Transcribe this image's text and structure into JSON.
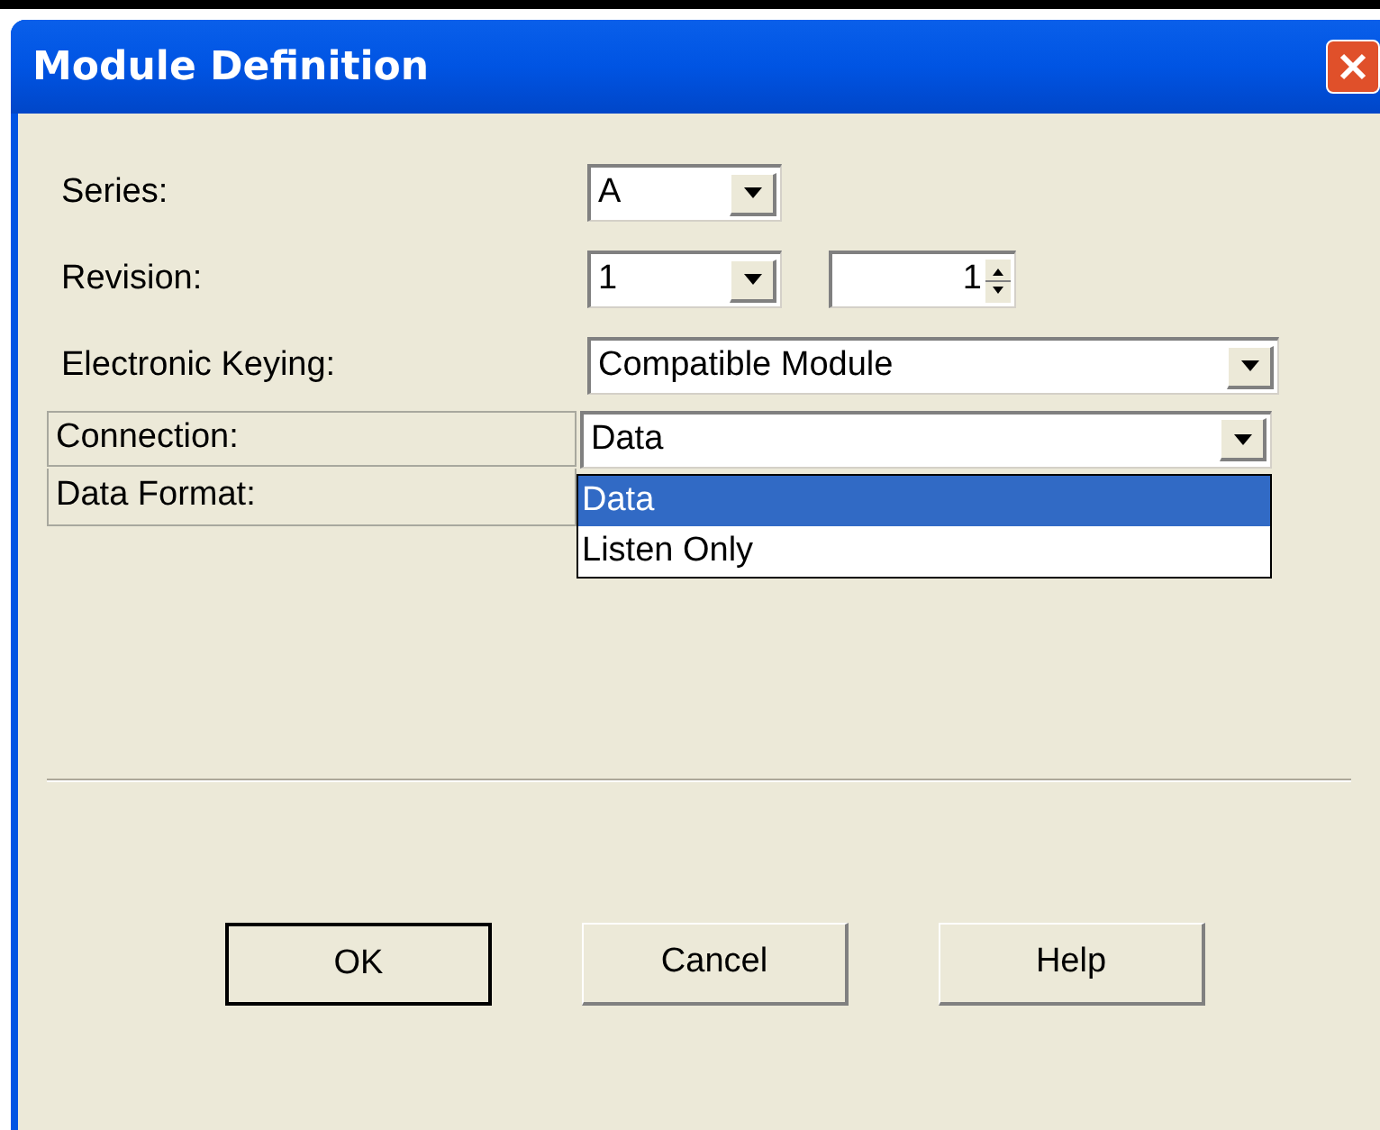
{
  "window": {
    "title": "Module Definition"
  },
  "fields": [
    {
      "kind": "combo",
      "label": "Series:",
      "value": "A"
    },
    {
      "kind": "combo_spin",
      "label": "Revision:",
      "value": "1",
      "spin_value": "1"
    },
    {
      "kind": "wide_combo",
      "label": "Electronic Keying:",
      "value": "Compatible Module"
    },
    {
      "kind": "grid_combo",
      "label": "Connection:",
      "value": "Data",
      "open": true,
      "options": [
        {
          "label": "Data",
          "selected": true
        },
        {
          "label": "Listen Only",
          "selected": false
        }
      ]
    },
    {
      "kind": "grid_label",
      "label": "Data Format:"
    }
  ],
  "buttons": [
    {
      "label": "OK",
      "default": true
    },
    {
      "label": "Cancel",
      "default": false
    },
    {
      "label": "Help",
      "default": false
    }
  ]
}
